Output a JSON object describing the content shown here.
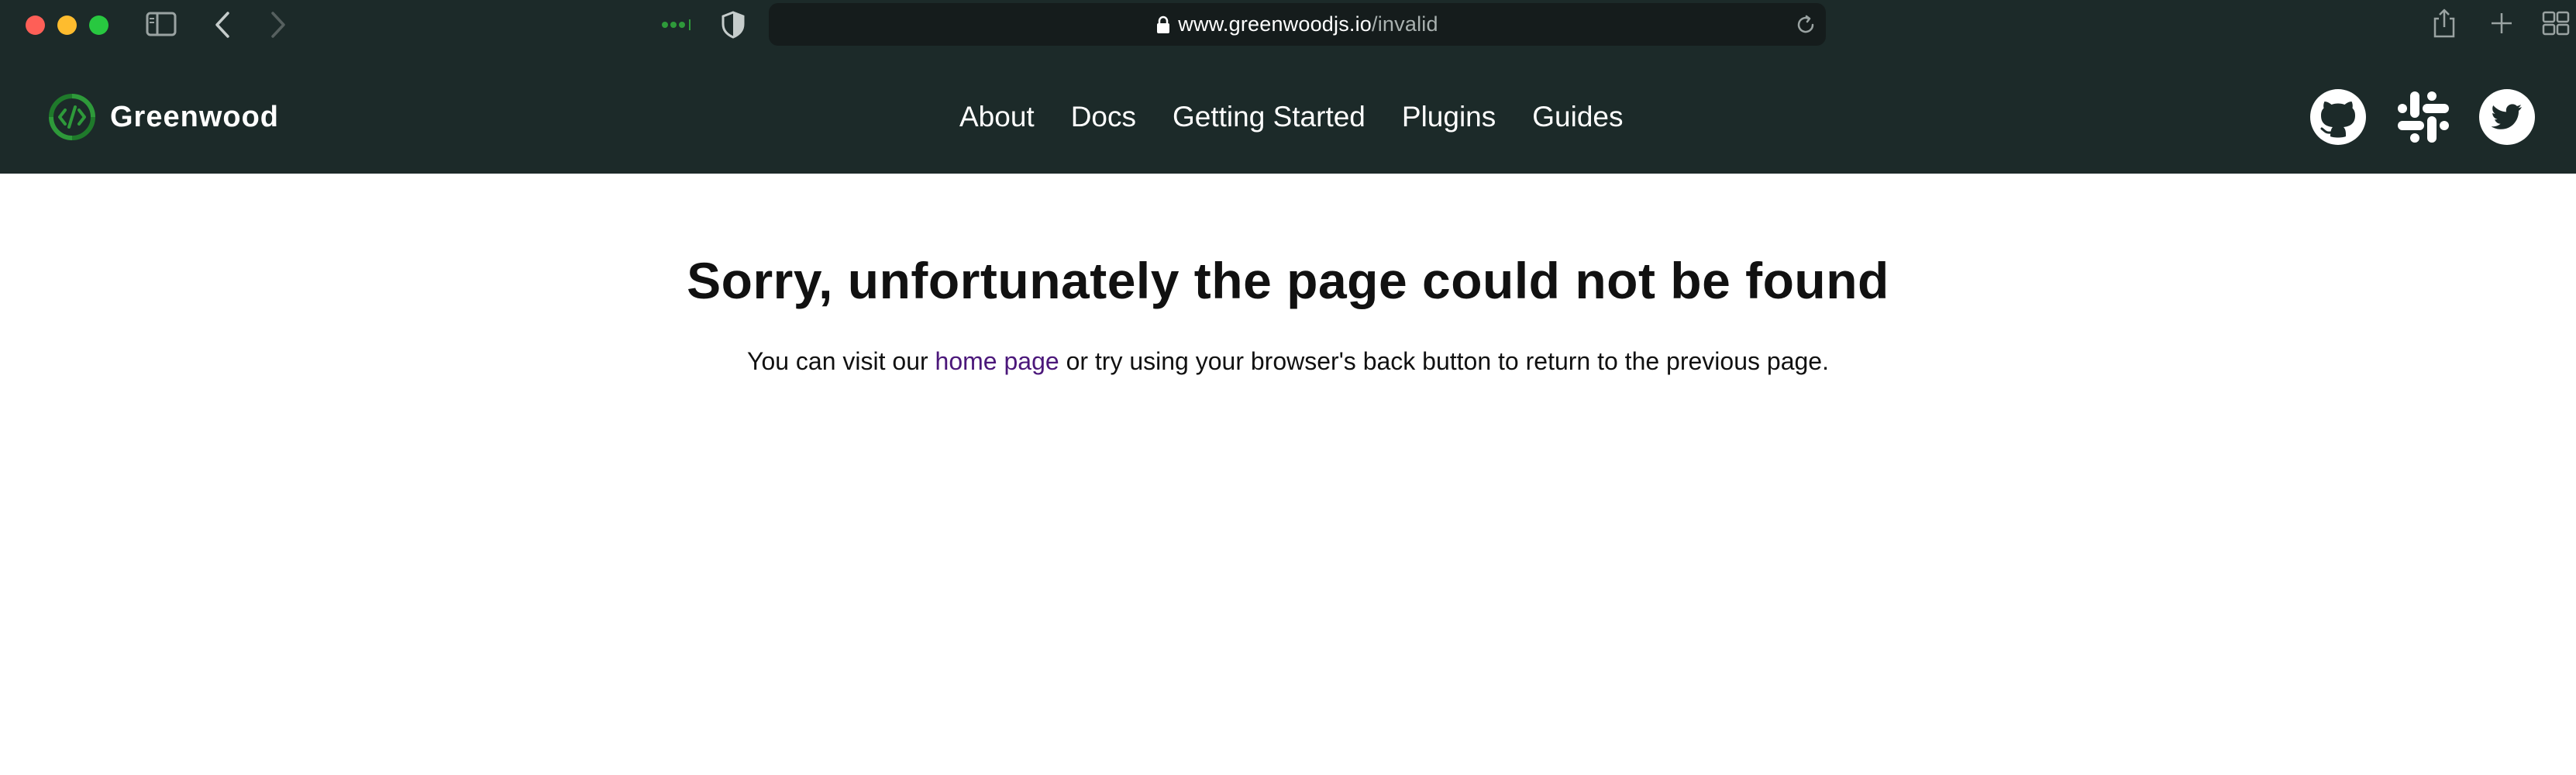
{
  "browser": {
    "url_host": "www.greenwoodjs.io",
    "url_path": "/invalid"
  },
  "header": {
    "brand_name": "Greenwood",
    "nav": [
      {
        "label": "About"
      },
      {
        "label": "Docs"
      },
      {
        "label": "Getting Started"
      },
      {
        "label": "Plugins"
      },
      {
        "label": "Guides"
      }
    ],
    "social": [
      "github-icon",
      "slack-icon",
      "twitter-icon"
    ]
  },
  "main": {
    "title": "Sorry, unfortunately the page could not be found",
    "message_before": "You can visit our ",
    "home_link": "home page",
    "message_after": " or try using your browser's back button to return to the previous page."
  },
  "colors": {
    "header_bg": "#1c2a29",
    "link": "#4b177a",
    "brand_green": "#2e9a3a"
  }
}
